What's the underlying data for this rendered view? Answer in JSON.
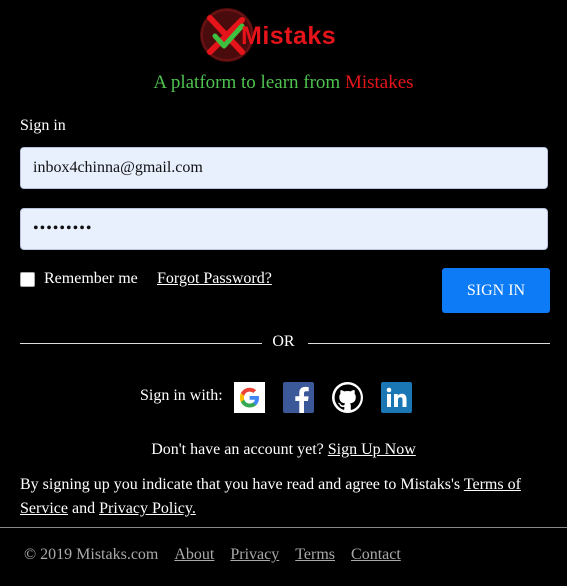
{
  "logo": {
    "text": "Mistaks"
  },
  "tagline": {
    "prefix": "A platform to learn from ",
    "highlight": "Mistakes"
  },
  "form": {
    "label": "Sign in",
    "email_value": "inbox4chinna@gmail.com",
    "password_value": "•••••••••",
    "remember_label": "Remember me",
    "forgot_label": "Forgot Password?",
    "signin_label": "SIGN IN"
  },
  "divider": {
    "or": "OR"
  },
  "social": {
    "label": "Sign in with:",
    "providers": [
      "google-icon",
      "facebook-icon",
      "github-icon",
      "linkedin-icon"
    ]
  },
  "signup": {
    "prefix": "Don't have an account yet? ",
    "link": "Sign Up Now"
  },
  "terms": {
    "prefix": "By signing up you indicate that you have read and agree to Mistaks's ",
    "terms_link": "Terms of Service",
    "middle": " and ",
    "privacy_link": "Privacy Policy."
  },
  "footer": {
    "copyright": "© 2019 Mistaks.com",
    "links": [
      "About",
      "Privacy",
      "Terms",
      "Contact"
    ]
  },
  "colors": {
    "accent": "#0c7bf5",
    "tagline_green": "#4fc24f",
    "highlight_red": "#e5141a",
    "input_bg": "#e8f0fe"
  }
}
